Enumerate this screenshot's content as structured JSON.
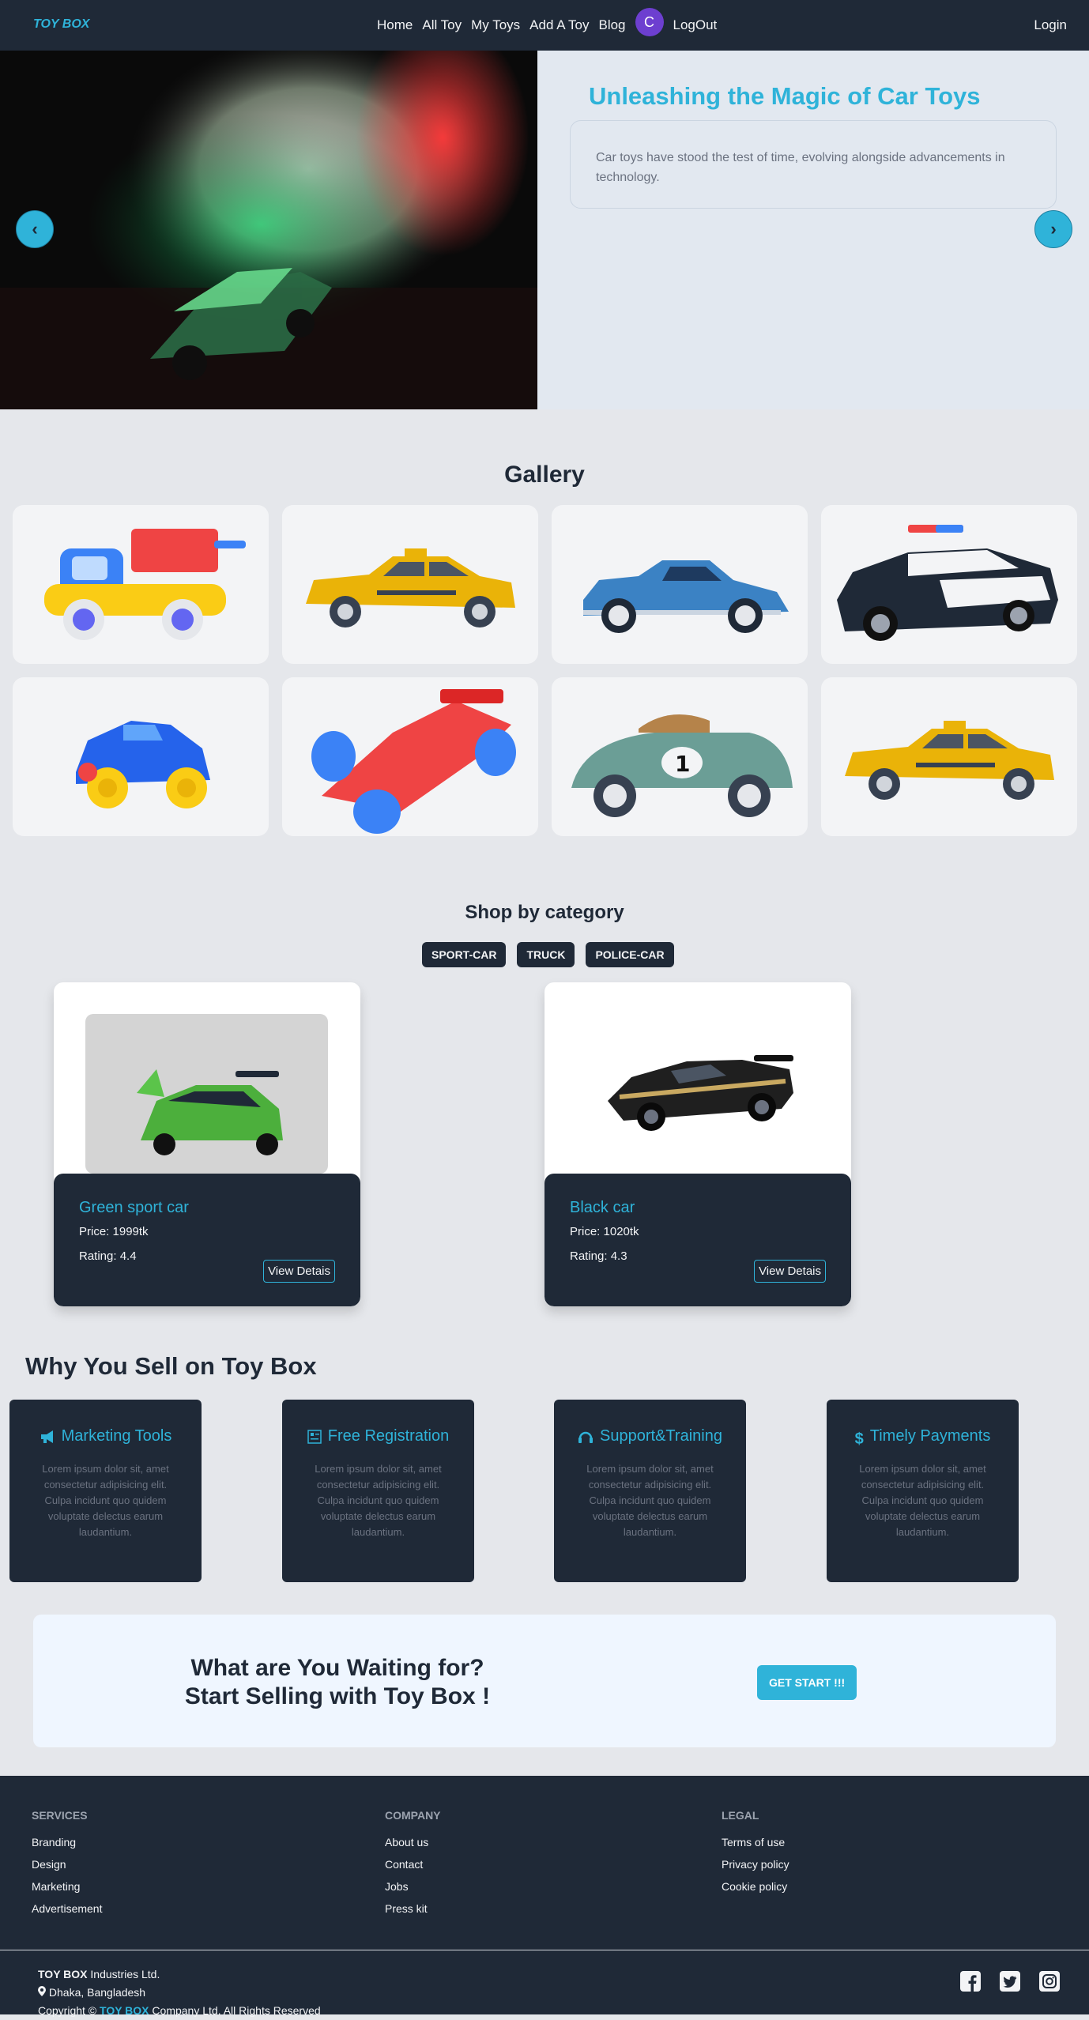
{
  "nav": {
    "logo": "TOY BOX",
    "links": [
      "Home",
      "All Toy",
      "My Toys",
      "Add A Toy",
      "Blog"
    ],
    "avatar_initial": "C",
    "logout": "LogOut",
    "login": "Login"
  },
  "hero": {
    "title": "Unleashing the Magic of Car Toys",
    "description": "Car toys have stood the test of time, evolving alongside advancements in technology.",
    "prev_symbol": "‹",
    "next_symbol": "›"
  },
  "gallery": {
    "title": "Gallery",
    "items": [
      "dump-truck-toy",
      "taxi-toy",
      "vintage-blue-car-toy",
      "police-car-toy",
      "blue-jeep-toy",
      "red-race-car-toy",
      "vintage-race-car-toy",
      "taxi-toy"
    ]
  },
  "category": {
    "title": "Shop by category",
    "tabs": [
      "SPORT-CAR",
      "TRUCK",
      "POLICE-CAR"
    ],
    "products": [
      {
        "name": "Green sport car",
        "price": "Price: 1999tk",
        "rating": "Rating: 4.4",
        "button": "View Detais"
      },
      {
        "name": "Black car",
        "price": "Price: 1020tk",
        "rating": "Rating: 4.3",
        "button": "View Detais"
      }
    ]
  },
  "why": {
    "title": "Why You Sell on Toy Box",
    "features": [
      {
        "title": "Marketing Tools",
        "icon": "megaphone-icon",
        "text": "Lorem ipsum dolor sit, amet consectetur adipisicing elit. Culpa incidunt quo quidem voluptate delectus earum laudantium."
      },
      {
        "title": "Free Registration",
        "icon": "registration-icon",
        "text": "Lorem ipsum dolor sit, amet consectetur adipisicing elit. Culpa incidunt quo quidem voluptate delectus earum laudantium."
      },
      {
        "title": "Support&Training",
        "icon": "headset-icon",
        "text": "Lorem ipsum dolor sit, amet consectetur adipisicing elit. Culpa incidunt quo quidem voluptate delectus earum laudantium."
      },
      {
        "title": "Timely Payments",
        "icon": "dollar-icon",
        "text": "Lorem ipsum dolor sit, amet consectetur adipisicing elit. Culpa incidunt quo quidem voluptate delectus earum laudantium."
      }
    ]
  },
  "cta": {
    "line1": "What are You Waiting for?",
    "line2": "Start Selling with Toy Box !",
    "button": "GET START !!!"
  },
  "footer": {
    "services": {
      "title": "SERVICES",
      "links": [
        "Branding",
        "Design",
        "Marketing",
        "Advertisement"
      ]
    },
    "company": {
      "title": "COMPANY",
      "links": [
        "About us",
        "Contact",
        "Jobs",
        "Press kit"
      ]
    },
    "legal": {
      "title": "LEGAL",
      "links": [
        "Terms of use",
        "Privacy policy",
        "Cookie policy"
      ]
    },
    "brand": "TOY BOX",
    "company_suffix": "Industries Ltd.",
    "location": "Dhaka, Bangladesh",
    "copyright_prefix": "Copyright ©",
    "copyright_suffix": "Company Ltd. All Rights Reserved",
    "social": [
      "facebook-icon",
      "twitter-icon",
      "instagram-icon"
    ]
  },
  "colors": {
    "accent": "#2fb3d9",
    "dark": "#1f2937",
    "bg": "#e5e7eb",
    "avatar": "#6d3fd0"
  }
}
